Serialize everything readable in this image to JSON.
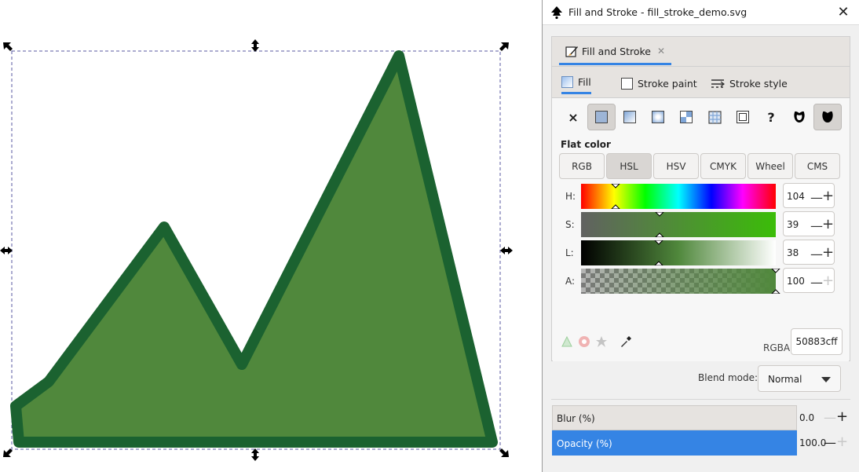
{
  "window": {
    "title": "Fill and Stroke - fill_stroke_demo.svg",
    "close_glyph": "✕"
  },
  "doc_tab": {
    "label": "Fill and Stroke",
    "close_glyph": "✕"
  },
  "subtabs": [
    {
      "label": "Fill",
      "active": true
    },
    {
      "label": "Stroke paint",
      "active": false
    },
    {
      "label": "Stroke style",
      "active": false
    }
  ],
  "paint_types": [
    {
      "name": "no-paint",
      "glyph": "×",
      "active": false
    },
    {
      "name": "flat-color",
      "active": true
    },
    {
      "name": "linear-gradient",
      "active": false
    },
    {
      "name": "radial-gradient",
      "active": false
    },
    {
      "name": "pattern",
      "active": false
    },
    {
      "name": "mesh",
      "active": false
    },
    {
      "name": "swatch",
      "active": false
    },
    {
      "name": "unset",
      "glyph": "?",
      "active": false
    },
    {
      "name": "fill-rule-evenodd",
      "active": false
    },
    {
      "name": "fill-rule-nonzero",
      "active": true
    }
  ],
  "flat_color_label": "Flat color",
  "color_modes": [
    "RGB",
    "HSL",
    "HSV",
    "CMYK",
    "Wheel",
    "CMS"
  ],
  "active_mode": "HSL",
  "sliders": {
    "h": {
      "label": "H:",
      "value": "104"
    },
    "s": {
      "label": "S:",
      "value": "39"
    },
    "l": {
      "label": "L:",
      "value": "38"
    },
    "a": {
      "label": "A:",
      "value": "100"
    }
  },
  "rgba": {
    "label": "RGBA:",
    "value": "50883cff"
  },
  "blend": {
    "label": "Blend mode:",
    "value": "Normal"
  },
  "blur": {
    "label": "Blur (%)",
    "value": "0.0"
  },
  "opacity": {
    "label": "Opacity (%)",
    "value": "100.0"
  },
  "colors": {
    "fill": "#50883c",
    "stroke": "#1b6230",
    "accent": "#3584e4"
  }
}
